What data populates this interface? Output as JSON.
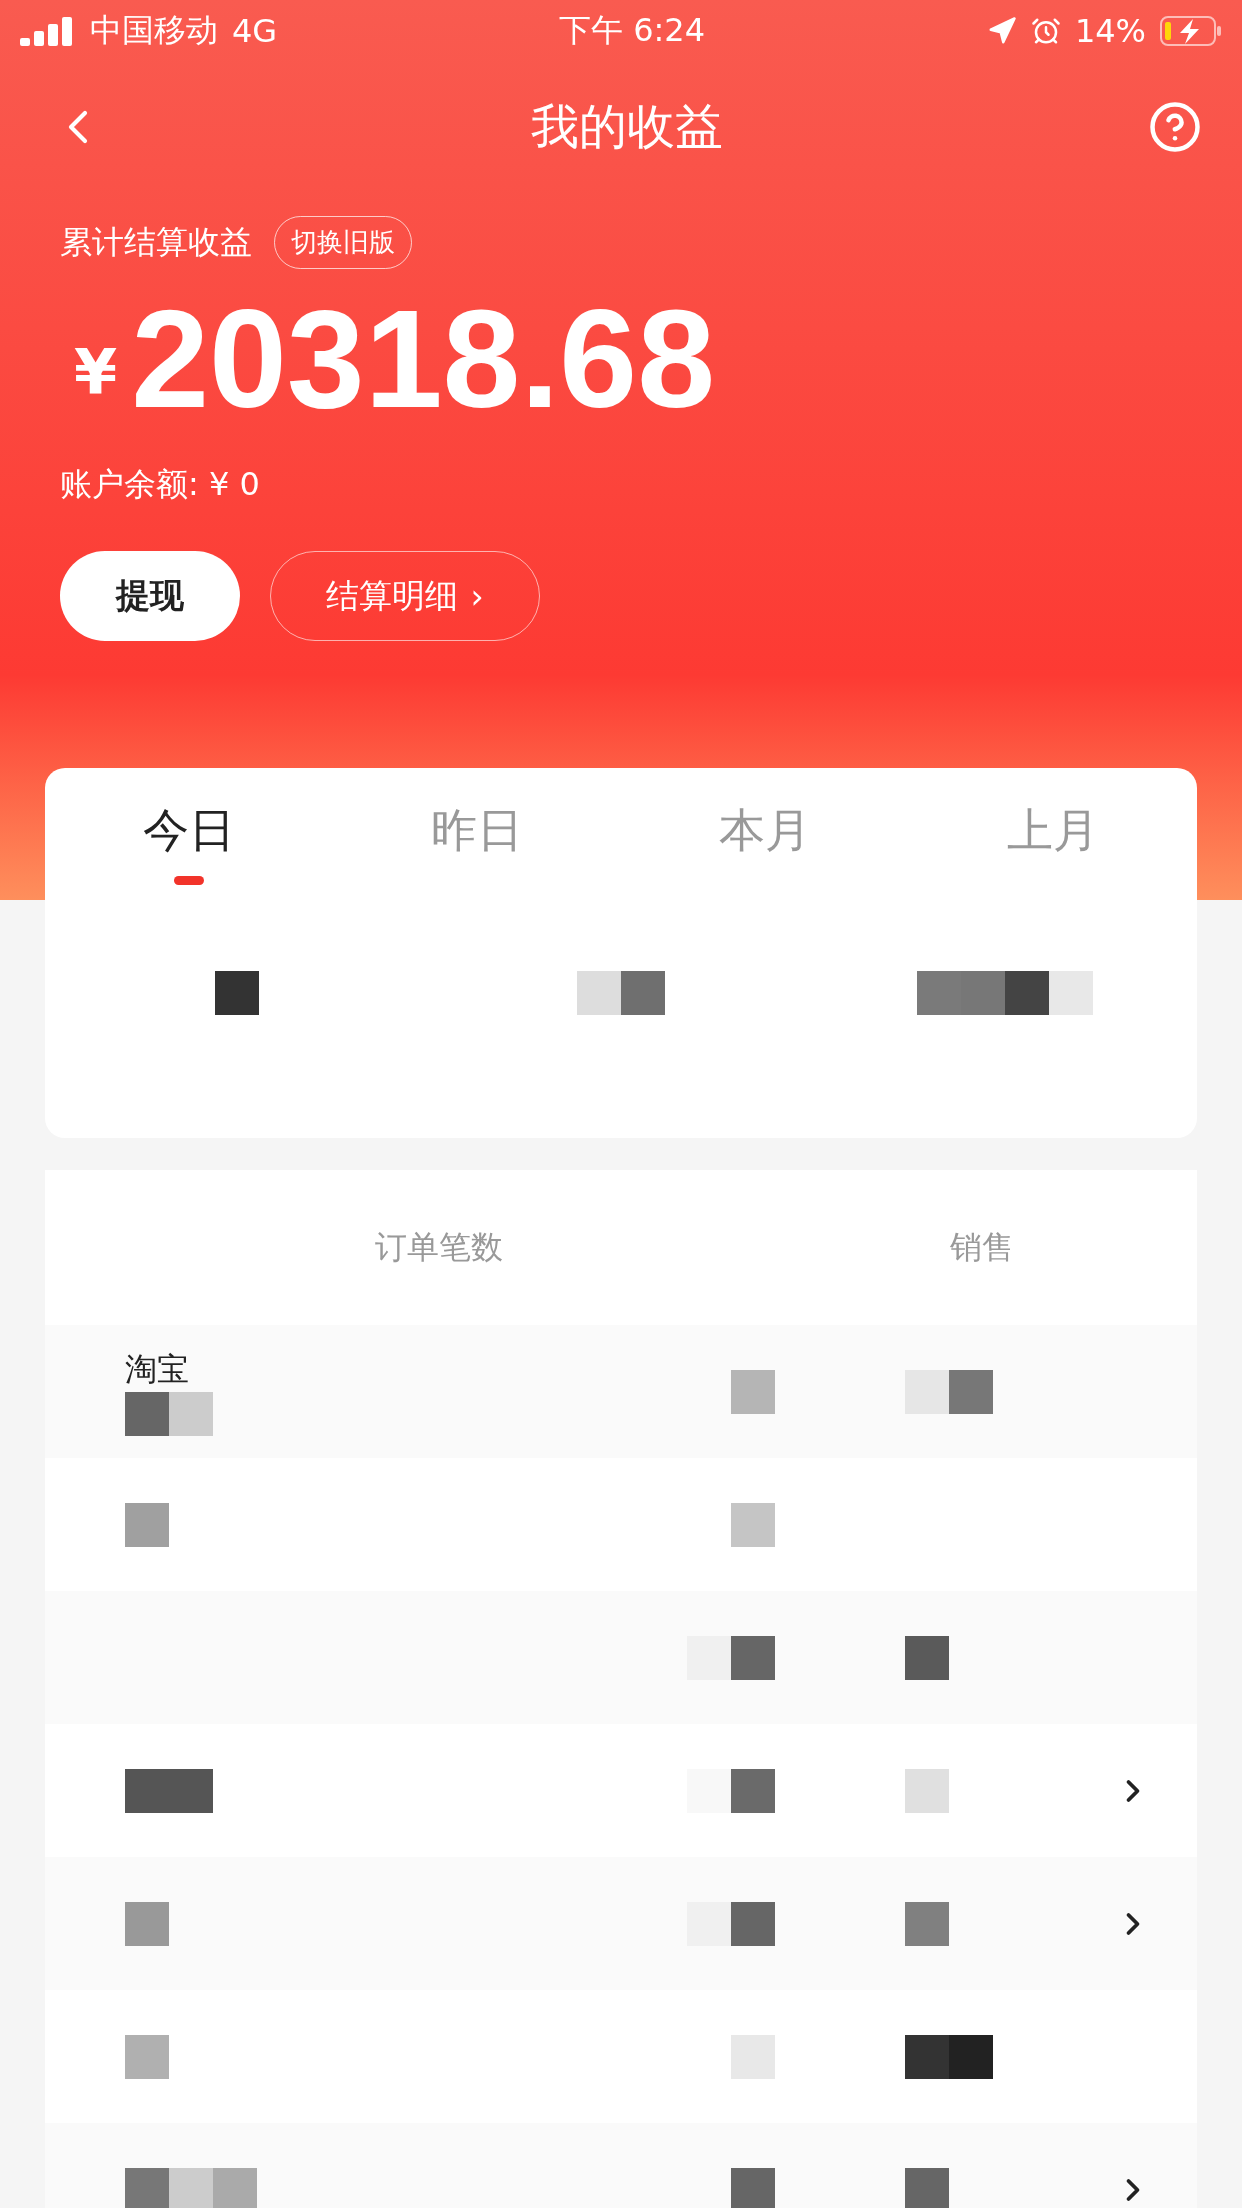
{
  "status_bar": {
    "carrier": "中国移动",
    "network": "4G",
    "time": "下午 6:24",
    "battery": "14%"
  },
  "nav": {
    "title": "我的收益"
  },
  "summary": {
    "label": "累计结算收益",
    "switch_button": "切换旧版",
    "currency": "¥",
    "amount": "20318.68",
    "balance": "账户余额: ¥ 0",
    "withdraw_button": "提现",
    "detail_button": "结算明细",
    "detail_arrow": "›"
  },
  "tabs": [
    {
      "label": "今日",
      "selected": true
    },
    {
      "label": "昨日",
      "selected": false
    },
    {
      "label": "本月",
      "selected": false
    },
    {
      "label": "上月",
      "selected": false
    }
  ],
  "table": {
    "columns": [
      "订单笔数",
      "销售"
    ],
    "rows": [
      {
        "name": "淘宝",
        "chevron": false
      },
      {
        "chevron": false
      },
      {
        "chevron": false
      },
      {
        "chevron": true
      },
      {
        "chevron": true
      },
      {
        "chevron": false
      },
      {
        "chevron": true
      }
    ]
  }
}
